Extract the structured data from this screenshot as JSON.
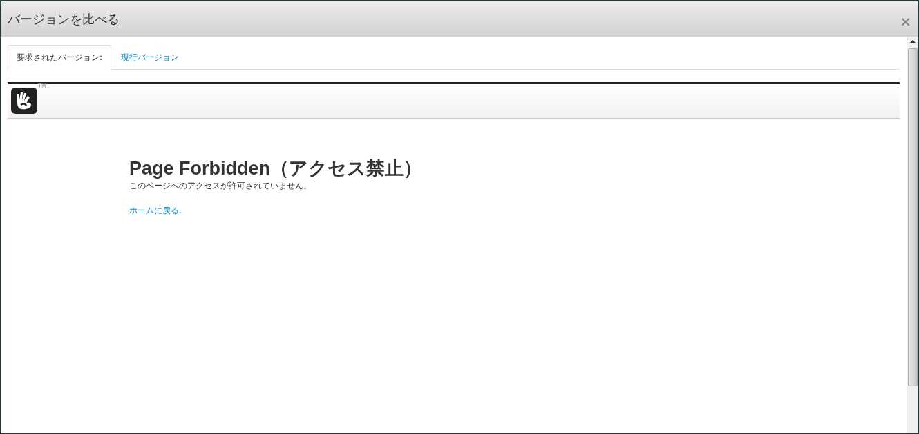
{
  "dialog": {
    "title": "バージョンを比べる",
    "close": "×"
  },
  "tabs": [
    {
      "label": "要求されたバージョン:",
      "selected": true
    },
    {
      "label": "現行バージョン",
      "selected": false
    }
  ],
  "site_header": {
    "trademark": "TM"
  },
  "content": {
    "heading": "Page Forbidden（アクセス禁止）",
    "message": "このページへのアクセスが許可されていません。",
    "link": "ホームに戻る."
  }
}
